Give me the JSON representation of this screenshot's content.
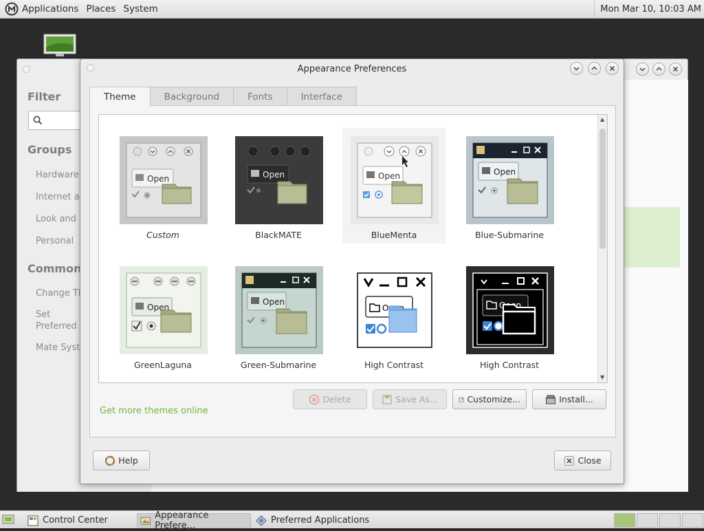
{
  "top_panel": {
    "menus": [
      "Applications",
      "Places",
      "System"
    ],
    "clock": "Mon Mar 10, 10:03 AM"
  },
  "control_center": {
    "filter_heading": "Filter",
    "groups_heading": "Groups",
    "groups": [
      "Hardware",
      "Internet and Network",
      "Look and Feel",
      "Personal"
    ],
    "common_heading": "Common Tasks",
    "tasks": [
      "Change Theme",
      "Set Preferred Applications",
      "Mate System Monitor"
    ]
  },
  "dialog": {
    "title": "Appearance Preferences",
    "tabs": [
      {
        "label": "Theme",
        "active": true
      },
      {
        "label": "Background",
        "active": false
      },
      {
        "label": "Fonts",
        "active": false
      },
      {
        "label": "Interface",
        "active": false
      }
    ],
    "themes": [
      {
        "name": "Custom",
        "italic": true,
        "open_label": "Open"
      },
      {
        "name": "BlackMATE",
        "italic": false,
        "open_label": "Open"
      },
      {
        "name": "BlueMenta",
        "italic": false,
        "selected": true,
        "open_label": "Open"
      },
      {
        "name": "Blue-Submarine",
        "italic": false,
        "open_label": "Open"
      },
      {
        "name": "GreenLaguna",
        "italic": false,
        "open_label": "Open"
      },
      {
        "name": "Green-Submarine",
        "italic": false,
        "open_label": "Open"
      },
      {
        "name": "High Contrast",
        "italic": false,
        "open_label": "Open"
      },
      {
        "name": "High Contrast",
        "italic": false,
        "open_label": "Open"
      }
    ],
    "buttons": {
      "delete": "Delete",
      "save_as": "Save As...",
      "customize": "Customize...",
      "install": "Install..."
    },
    "more_link": "Get more themes online",
    "help": "Help",
    "close": "Close"
  },
  "taskbar": [
    {
      "label": "Control Center",
      "active": false
    },
    {
      "label": "Appearance Prefere...",
      "active": true
    },
    {
      "label": "Preferred Applications",
      "active": false
    }
  ],
  "colors": {
    "link_green": "#73b33e",
    "workspace_active": "#a6c67a"
  }
}
